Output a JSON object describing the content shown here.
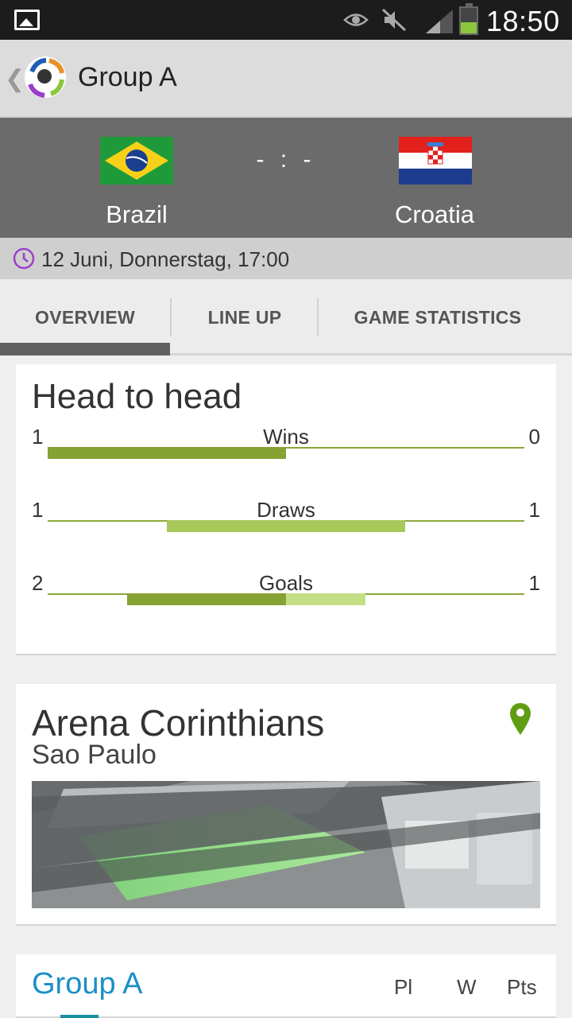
{
  "statusbar": {
    "time": "18:50"
  },
  "actionbar": {
    "title": "Group A"
  },
  "match": {
    "home": "Brazil",
    "away": "Croatia",
    "score": "- : -",
    "datetime": "12 Juni, Donnerstag, 17:00"
  },
  "tabs": [
    "OVERVIEW",
    "LINE UP",
    "GAME STATISTICS"
  ],
  "head_to_head": {
    "title": "Head to head",
    "rows": [
      {
        "label": "Wins",
        "home": "1",
        "away": "0"
      },
      {
        "label": "Draws",
        "home": "1",
        "away": "1"
      },
      {
        "label": "Goals",
        "home": "2",
        "away": "1"
      }
    ]
  },
  "venue": {
    "name": "Arena Corinthians",
    "city": "Sao Paulo"
  },
  "group": {
    "title": "Group A",
    "columns": [
      "Pl",
      "W",
      "Pts"
    ]
  },
  "colors": {
    "home_bar": "#86a234",
    "away_bar": "#c2df85",
    "draw_bar": "#a8c85a",
    "accent_blue": "#1a8fc6"
  }
}
